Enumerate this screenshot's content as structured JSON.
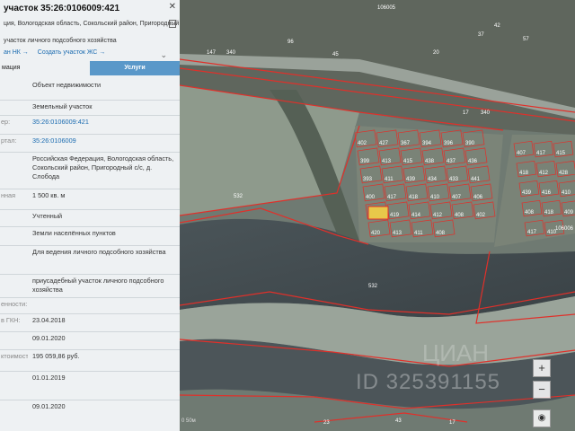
{
  "panel": {
    "title": "участок 35:26:0106009:421",
    "address_short": "ция, Вологодская область, Сокольский район, Пригородный",
    "purpose_short": "участок личного подсобного хозяйства",
    "link_nk": "ан НК →",
    "link_zhs": "Создать участок ЖС →",
    "close": "✕",
    "pin": "⌄"
  },
  "tabs": [
    {
      "label": "мация"
    },
    {
      "label": "Услуги"
    }
  ],
  "rows": [
    {
      "key": "",
      "value": "Объект недвижимости"
    },
    {
      "key": "",
      "value": "Земельный участок"
    },
    {
      "key": "ер:",
      "value": "35:26:0106009:421",
      "link": true
    },
    {
      "key": "ртал:",
      "value": "35:26:0106009",
      "link": true
    },
    {
      "key": "",
      "value": "Российская Федерация, Вологодская область, Сокольский район, Пригородный с/с, д. Слобода"
    },
    {
      "key": "нная",
      "value": "1 500 кв. м"
    },
    {
      "key": "",
      "value": "Учтенный"
    },
    {
      "key": "",
      "value": "Земли населённых пунктов"
    },
    {
      "key": "",
      "value": "Для ведения личного подсобного хозяйства"
    },
    {
      "key": "",
      "value": "приусадебный участок личного подсобного хозяйства"
    },
    {
      "key": "енности:",
      "value": ""
    },
    {
      "key": "в ГКН:",
      "value": "23.04.2018"
    },
    {
      "key": "",
      "value": "09.01.2020"
    },
    {
      "key": "ктоимость:",
      "value": "195 059,86 руб."
    },
    {
      "key": "",
      "value": "01.01.2019"
    },
    {
      "key": "",
      "value": "09.01.2020"
    }
  ],
  "map": {
    "parcels_left": [
      "402",
      "427",
      "367",
      "394",
      "396",
      "390",
      "399",
      "413",
      "415",
      "438",
      "437",
      "436",
      "393",
      "411",
      "439",
      "434",
      "433",
      "441",
      "400",
      "417",
      "418",
      "410",
      "407",
      "406",
      "421",
      "419",
      "414",
      "412",
      "408",
      "402",
      "420",
      "413",
      "411",
      "408"
    ],
    "parcels_right": [
      "407",
      "417",
      "415",
      "418",
      "412",
      "428",
      "439",
      "416",
      "410",
      "408",
      "418",
      "409",
      "417",
      "410"
    ],
    "top_labels": [
      "147",
      "340",
      "96",
      "45",
      "20",
      "37",
      "42",
      "57"
    ],
    "road_labels": [
      "17",
      "340"
    ],
    "big_labels": [
      "532",
      "532"
    ],
    "bottom_labels": [
      "23",
      "43",
      "17"
    ],
    "top_code": "106005",
    "right_code": "106006",
    "scale_label": "0 50м",
    "zoom_in": "+",
    "zoom_out": "−",
    "locate": "◉",
    "watermark": "ID 325391155",
    "watermark_brand": "ЦИАН"
  },
  "colors": {
    "tab_active": "#5a98c9",
    "link": "#1a6bb0",
    "parcel_border": "#e0302a",
    "selected_parcel": "#e8c84a"
  }
}
